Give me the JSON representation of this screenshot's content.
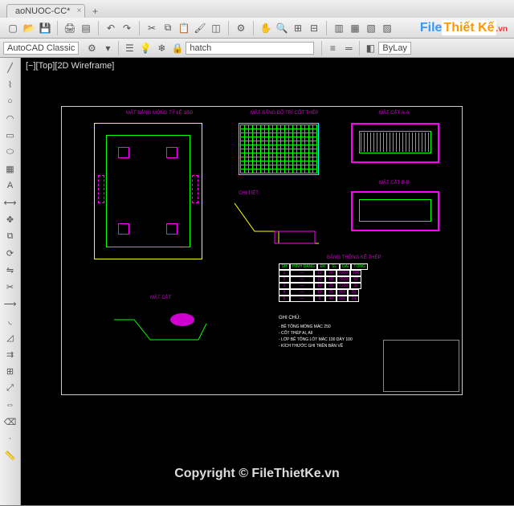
{
  "file_tab": {
    "name": "aoNUOC-CC*",
    "close": "×"
  },
  "tab_plus": "+",
  "workspace": "AutoCAD Classic",
  "layer_dropdown": "hatch",
  "style_dropdown": "ByLay",
  "view_label": "[−][Top][2D Wireframe]",
  "watermark": {
    "part1": "File",
    "part2": "Thiết Kế",
    "part3": ".vn"
  },
  "copyright": "Copyright © FileThietKe.vn",
  "toolbar_icons": [
    "new",
    "open",
    "save",
    "print",
    "plot",
    "undo",
    "redo",
    "cut",
    "copy",
    "paste",
    "match",
    "block",
    "pan",
    "zoom-ext",
    "zoom-win",
    "zoom",
    "props",
    "sheet",
    "tool",
    "layer",
    "dim"
  ],
  "left_tools": [
    "line",
    "polyline",
    "circle",
    "arc",
    "rect",
    "ellipse",
    "hatch",
    "text",
    "dim",
    "move",
    "copy",
    "rotate",
    "mirror",
    "trim",
    "extend",
    "fillet",
    "chamfer",
    "offset",
    "array",
    "scale",
    "stretch",
    "measure",
    "point",
    "erase"
  ],
  "drawing": {
    "titles": {
      "plan": "MẶT BẰNG MÓNG TỶ LỆ 1/50",
      "section1": "MẶT CẮT A-A",
      "detail": "CHI TIẾT",
      "section2": "MẶT CẮT B-B",
      "rebar_plan": "MẶT BẰNG BỐ TRÍ CỐT THÉP",
      "table_title": "BẢNG THỐNG KÊ THÉP",
      "notes_title": "GHI CHÚ:"
    },
    "notes": [
      "- BÊ TÔNG MÓNG MÁC 250",
      "- CỐT THÉP AI, AII",
      "- LỚP BÊ TÔNG LÓT MÁC 100 DÀY 100",
      "- KÍCH THƯỚC GHI TRÊN BẢN VẼ"
    ],
    "table": {
      "headers": [
        "SH",
        "HÌNH DẠNG",
        "ĐK",
        "SL",
        "DÀI",
        "TỔNG"
      ],
      "rows": [
        [
          "1",
          "—",
          "12",
          "20",
          "5000",
          "100"
        ],
        [
          "2",
          "—",
          "12",
          "18",
          "3500",
          "63"
        ],
        [
          "3",
          "—",
          "10",
          "25",
          "1200",
          "30"
        ],
        [
          "4",
          "—",
          "10",
          "25",
          "800",
          "20"
        ],
        [
          "5",
          "—",
          "8",
          "40",
          "600",
          "24"
        ]
      ]
    }
  }
}
